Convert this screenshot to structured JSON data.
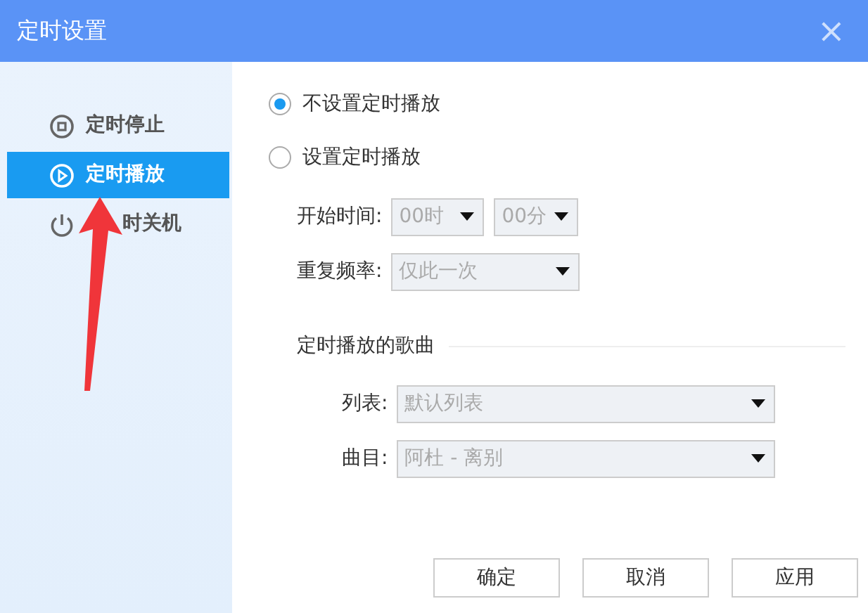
{
  "window": {
    "title": "定时设置",
    "close": "×"
  },
  "sidebar": {
    "items": [
      {
        "label": "定时停止",
        "kind": "stop",
        "selected": false,
        "partly_covered": false
      },
      {
        "label": "定时播放",
        "kind": "play",
        "selected": true,
        "partly_covered": false
      },
      {
        "label": "时关机",
        "kind": "power",
        "selected": false,
        "partly_covered": true
      }
    ]
  },
  "options": [
    {
      "label": "不设置定时播放",
      "selected": true
    },
    {
      "label": "设置定时播放",
      "selected": false
    }
  ],
  "schedule": {
    "start_label": "开始时间:",
    "hour": {
      "value": "00时",
      "disabled": true
    },
    "minute": {
      "value": "00分",
      "disabled": true
    },
    "repeat_label": "重复频率:",
    "repeat": {
      "value": "仅此一次",
      "disabled": true
    }
  },
  "song_section": {
    "title": "定时播放的歌曲",
    "list_label": "列表:",
    "list": {
      "value": "默认列表",
      "disabled": true
    },
    "track_label": "曲目:",
    "track": {
      "value": "阿杜 - 离别",
      "disabled": true
    }
  },
  "buttons": [
    "确定",
    "取消",
    "应用"
  ],
  "annotation": {
    "kind": "arrow"
  }
}
